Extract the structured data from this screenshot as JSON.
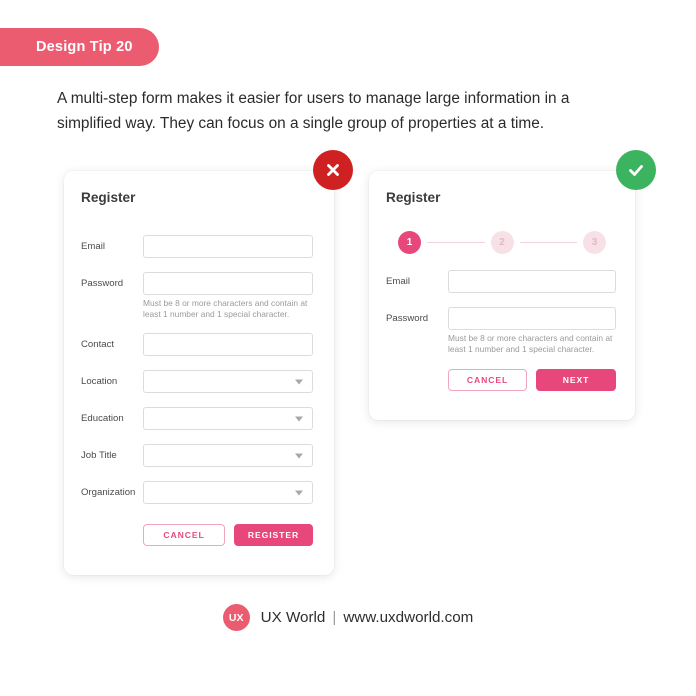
{
  "badge": {
    "label": "Design Tip 20",
    "color": "#ec5c70"
  },
  "intro": "A multi-step form makes it easier for users to manage large information in a simplified way. They can focus on a single group of properties at a time.",
  "status": {
    "bad": {
      "icon": "cross-icon",
      "color": "#cf2121"
    },
    "good": {
      "icon": "check-icon",
      "color": "#3cb45f"
    }
  },
  "bad_example": {
    "title": "Register",
    "fields": [
      {
        "label": "Email",
        "type": "text",
        "value": ""
      },
      {
        "label": "Password",
        "type": "text",
        "value": ""
      },
      {
        "label": "Contact",
        "type": "text",
        "value": ""
      },
      {
        "label": "Location",
        "type": "select",
        "value": ""
      },
      {
        "label": "Education",
        "type": "select",
        "value": ""
      },
      {
        "label": "Job Title",
        "type": "select",
        "value": ""
      },
      {
        "label": "Organization",
        "type": "select",
        "value": ""
      }
    ],
    "helper": "Must be 8 or more characters and contain at least 1 number and 1 special character.",
    "cancel_label": "CANCEL",
    "submit_label": "REGISTER"
  },
  "good_example": {
    "title": "Register",
    "steps": [
      {
        "label": "1",
        "state": "active"
      },
      {
        "label": "2",
        "state": "idle"
      },
      {
        "label": "3",
        "state": "idle"
      }
    ],
    "fields": [
      {
        "label": "Email",
        "type": "text",
        "value": ""
      },
      {
        "label": "Password",
        "type": "text",
        "value": ""
      }
    ],
    "helper": "Must be 8 or more characters and contain at least 1 number and 1 special character.",
    "cancel_label": "CANCEL",
    "submit_label": "NEXT"
  },
  "footer": {
    "logo_text": "UX",
    "brand": "UX World",
    "separator": "|",
    "url": "www.uxdworld.com"
  },
  "colors": {
    "accent_pink": "#e8477c",
    "badge_red": "#ec5c70",
    "error_red": "#cf2121",
    "success_green": "#3cb45f"
  }
}
